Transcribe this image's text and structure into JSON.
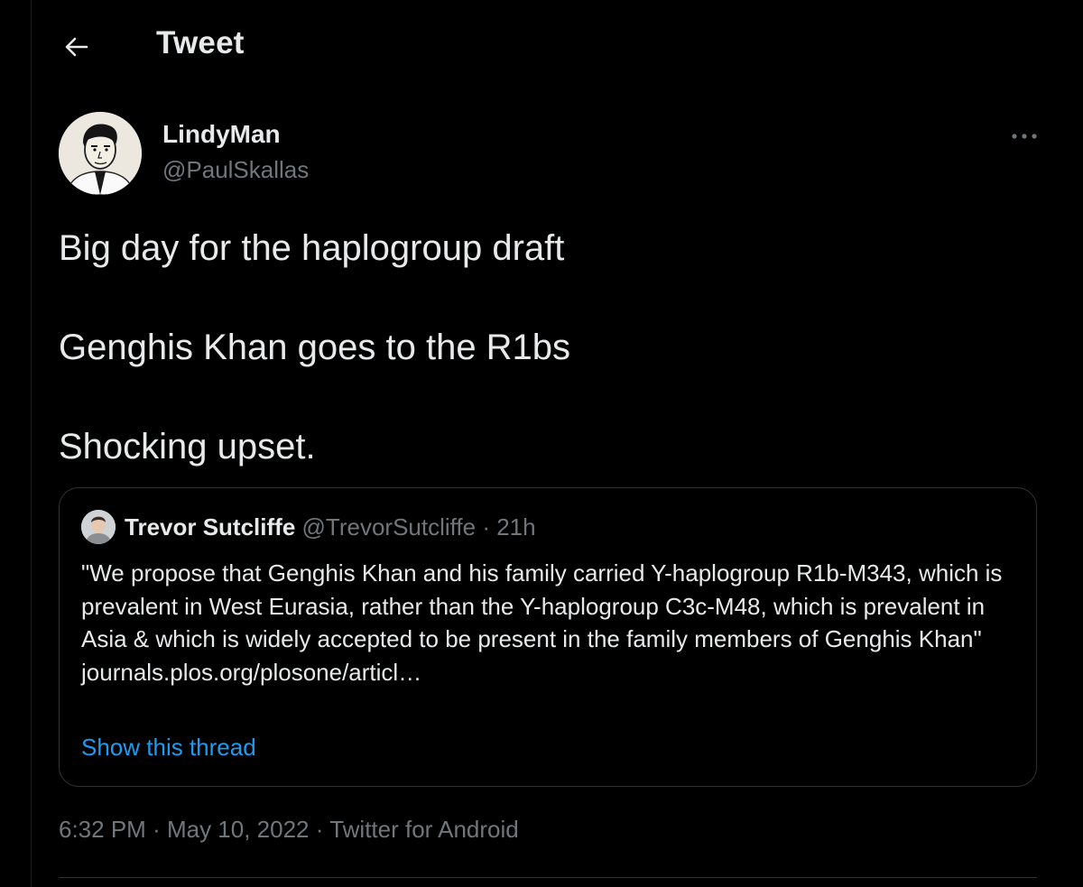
{
  "header": {
    "back_icon": "arrow-left-icon",
    "title": "Tweet"
  },
  "tweet": {
    "author": {
      "display_name": "LindyMan",
      "handle": "@PaulSkallas",
      "avatar": "cartoon-man-avatar"
    },
    "more_icon": "more-horizontal-icon",
    "lines": [
      "Big day for the haplogroup draft",
      "Genghis Khan goes to the R1bs",
      "Shocking upset."
    ],
    "quote": {
      "author": {
        "display_name": "Trevor Sutcliffe",
        "handle": "@TrevorSutcliffe",
        "separator": "·",
        "time": "21h",
        "avatar": "person-photo-avatar"
      },
      "text": "\"We propose that Genghis Khan and his family carried Y-haplogroup R1b-M343, which is prevalent in West Eurasia, rather than the Y-haplogroup C3c-M48, which is prevalent in Asia & which is widely accepted to be present in the family members of Genghis Khan\"",
      "link": "journals.plos.org/plosone/articl…",
      "show_thread": "Show this thread"
    },
    "meta": {
      "time": "6:32 PM",
      "separator": "·",
      "date": "May 10, 2022",
      "client": "Twitter for Android"
    }
  },
  "colors": {
    "background": "#000000",
    "text_primary": "#e7e9ea",
    "text_secondary": "#71767b",
    "accent": "#1d9bf0",
    "border": "#2f3336"
  }
}
